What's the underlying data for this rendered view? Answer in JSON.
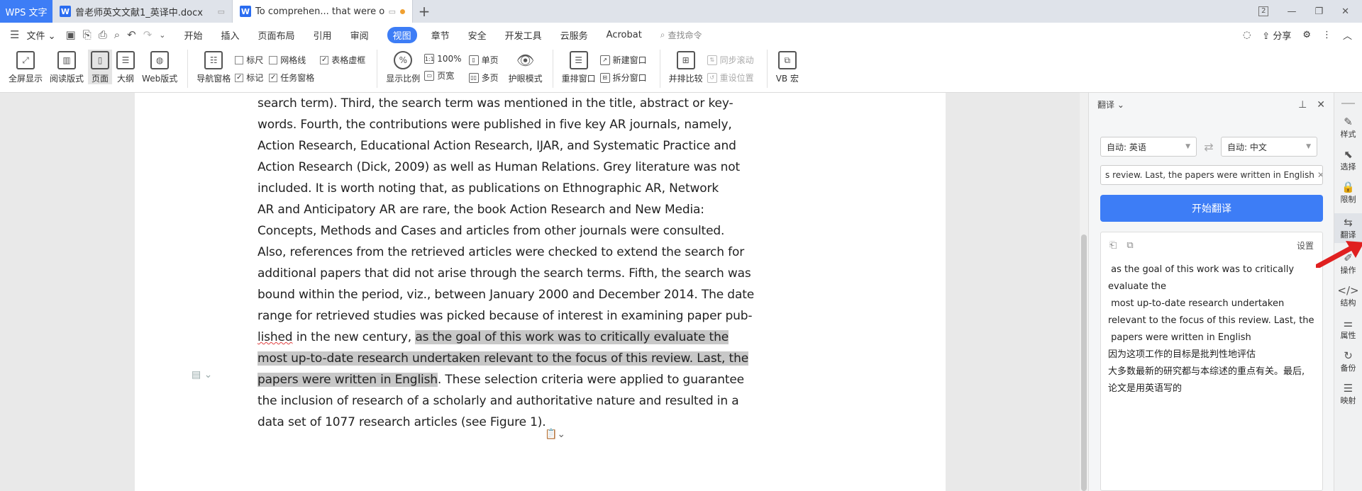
{
  "titlebar": {
    "home_tab": "WPS 文字",
    "tabs": [
      {
        "name": "曾老师英文文献1_英译中.docx"
      },
      {
        "name": "To comprehen... that were o"
      }
    ],
    "new_tab": "+",
    "badge": "2"
  },
  "menubar": {
    "file": "文件",
    "items": [
      "开始",
      "插入",
      "页面布局",
      "引用",
      "审阅",
      "视图",
      "章节",
      "安全",
      "开发工具",
      "云服务",
      "Acrobat"
    ],
    "active_index": 5,
    "search_placeholder": "查找命令",
    "share": "分享"
  },
  "ribbon": {
    "big_buttons_1": [
      "全屏显示",
      "阅读版式",
      "页面",
      "大纲",
      "Web版式"
    ],
    "nav_pane": "导航窗格",
    "checks_col1": [
      {
        "label": "标尺",
        "checked": false
      },
      {
        "label": "标记",
        "checked": true
      }
    ],
    "checks_col2": [
      {
        "label": "网格线",
        "checked": false
      },
      {
        "label": "任务窗格",
        "checked": true
      }
    ],
    "checks_col3": [
      {
        "label": "表格虚框",
        "checked": true
      }
    ],
    "zoom_btn": "显示比例",
    "zoom_small": [
      "100%",
      "页宽"
    ],
    "page_small": [
      "单页",
      "多页"
    ],
    "eye_mode": "护眼模式",
    "rearrange": "重排窗口",
    "window_small": [
      "新建窗口",
      "拆分窗口"
    ],
    "compare": "并排比较",
    "sync_small": [
      "同步滚动",
      "重设位置"
    ],
    "vb": "VB 宏"
  },
  "document": {
    "lines": [
      [
        {
          "t": "search term). Third, the search term was mentioned in the title, abstract or key-"
        }
      ],
      [
        {
          "t": "words. Fourth, the contributions were published in five key AR journals, namely,"
        }
      ],
      [
        {
          "t": "Action Research, Educational Action Research, IJAR, and Systematic Practice and"
        }
      ],
      [
        {
          "t": "Action Research (Dick, 2009) as well as Human Relations. Grey literature was not"
        }
      ],
      [
        {
          "t": "included. It is worth noting that, as publications on Ethnographic AR, Network"
        }
      ],
      [
        {
          "t": "AR and Anticipatory AR are rare, the book Action Research and New Media:"
        }
      ],
      [
        {
          "t": "Concepts, Methods and Cases and articles from other journals were consulted."
        }
      ],
      [
        {
          "t": "Also, references from the retrieved articles were checked to extend the search for"
        }
      ],
      [
        {
          "t": "additional papers that did not arise through the search terms. Fifth, the search was"
        }
      ],
      [
        {
          "t": "bound within the period, viz., between January 2000 and December 2014.  The date"
        }
      ],
      [
        {
          "t": "range for retrieved studies was picked because of interest in examining paper pub-"
        }
      ],
      [
        {
          "t": "lished",
          "s": "squig"
        },
        {
          "t": " in the new century, "
        },
        {
          "t": "as the goal of this work was to critically evaluate the ",
          "s": "hl"
        }
      ],
      [
        {
          "t": "most up-to-date research undertaken relevant to the focus of this review. Last, the ",
          "s": "hl"
        }
      ],
      [
        {
          "t": "papers were written in English",
          "s": "hl"
        },
        {
          "t": ". These selection criteria were applied to guarantee"
        }
      ],
      [
        {
          "t": "the inclusion of research of a scholarly and authoritative nature and resulted in a"
        }
      ],
      [
        {
          "t": "data set of 1077 research articles (see Figure 1)."
        }
      ]
    ]
  },
  "translate_panel": {
    "title": "翻译",
    "source_lang": "自动: 英语",
    "target_lang": "自动: 中文",
    "source_input": "s review. Last, the  papers were written in English",
    "start_button": "开始翻译",
    "settings": "设置",
    "result_lines": [
      " as the goal of this work was to critically evaluate the",
      " most up-to-date research undertaken relevant to the focus of this review. Last, the",
      " papers were written in English",
      "因为这项工作的目标是批判性地评估",
      "大多数最新的研究都与本综述的重点有关。最后,",
      "论文是用英语写的"
    ]
  },
  "rail": {
    "items": [
      "样式",
      "选择",
      "限制",
      "翻译",
      "操作",
      "结构",
      "属性",
      "备份",
      "映射"
    ],
    "active_index": 3
  },
  "colors": {
    "accent": "#3d7df6",
    "highlight": "#c8c8c8",
    "arrow": "#e02020"
  }
}
